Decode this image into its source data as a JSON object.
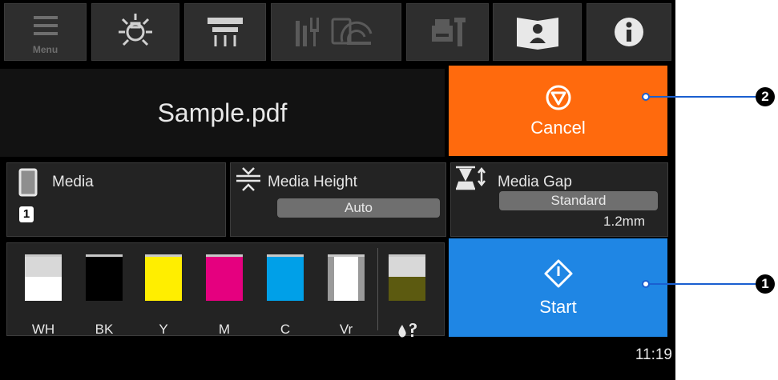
{
  "toolbar": {
    "menu_label": "Menu",
    "icons": [
      "menu-icon",
      "lamp-icon",
      "heater-icon",
      "network-status-icon",
      "maintenance-icon",
      "manual-icon",
      "info-icon"
    ]
  },
  "job": {
    "name": "Sample.pdf",
    "cancel_label": "Cancel",
    "start_label": "Start"
  },
  "media": {
    "title": "Media",
    "slot": "1"
  },
  "media_height": {
    "title": "Media Height",
    "value": "Auto"
  },
  "media_gap": {
    "title": "Media Gap",
    "value": "Standard",
    "detail": "1.2mm"
  },
  "inks": [
    {
      "label": "WH",
      "color": "#ffffff",
      "level": 0.55
    },
    {
      "label": "BK",
      "color": "#000000",
      "level": 1.0
    },
    {
      "label": "Y",
      "color": "#ffee00",
      "level": 1.0
    },
    {
      "label": "M",
      "color": "#e5007f",
      "level": 1.0
    },
    {
      "label": "C",
      "color": "#00a0e8",
      "level": 1.0
    },
    {
      "label": "Vr",
      "color": "#ffffff",
      "level": 1.0
    }
  ],
  "waste_ink": {
    "color": "#5c5a10",
    "level": 0.55
  },
  "status": {
    "clock": "11:19"
  },
  "callouts": {
    "start": "1",
    "cancel": "2"
  },
  "colors": {
    "cancel": "#ff6a0d",
    "start": "#1f86e4",
    "callout": "#1a5fd0"
  }
}
